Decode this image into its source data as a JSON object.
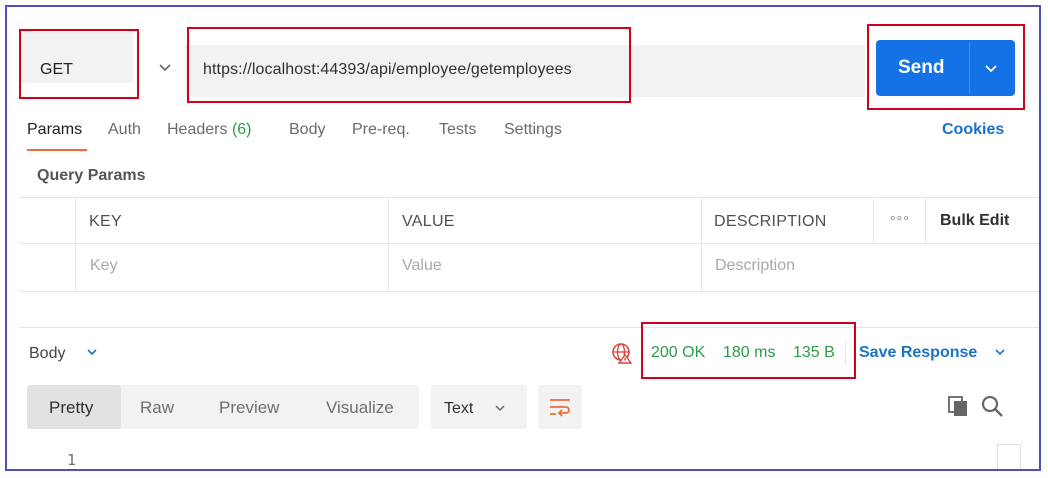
{
  "request": {
    "method": "GET",
    "url": "https://localhost:44393/api/employee/getemployees",
    "send_label": "Send"
  },
  "tabs": [
    {
      "label": "Params"
    },
    {
      "label": "Auth"
    },
    {
      "label": "Headers",
      "count": "(6)"
    },
    {
      "label": "Body"
    },
    {
      "label": "Pre-req."
    },
    {
      "label": "Tests"
    },
    {
      "label": "Settings"
    }
  ],
  "cookies_label": "Cookies",
  "query_params": {
    "title": "Query Params",
    "headers": [
      "KEY",
      "VALUE",
      "DESCRIPTION"
    ],
    "more_label": "◦◦◦",
    "bulk_edit_label": "Bulk Edit",
    "placeholders": [
      "Key",
      "Value",
      "Description"
    ]
  },
  "response": {
    "body_label": "Body",
    "status": "200 OK",
    "time": "180 ms",
    "size": "135 B",
    "save_label": "Save Response",
    "view_modes": [
      "Pretty",
      "Raw",
      "Preview",
      "Visualize"
    ],
    "active_view": "Pretty",
    "format": "Text",
    "line_number": "1"
  },
  "colors": {
    "accent_blue": "#1472e6",
    "link_blue": "#1a73c9",
    "status_green": "#2a9d4a",
    "tab_underline": "#f26b3a",
    "highlight_red": "#d0021b",
    "frame_border": "#4a4fc2"
  }
}
